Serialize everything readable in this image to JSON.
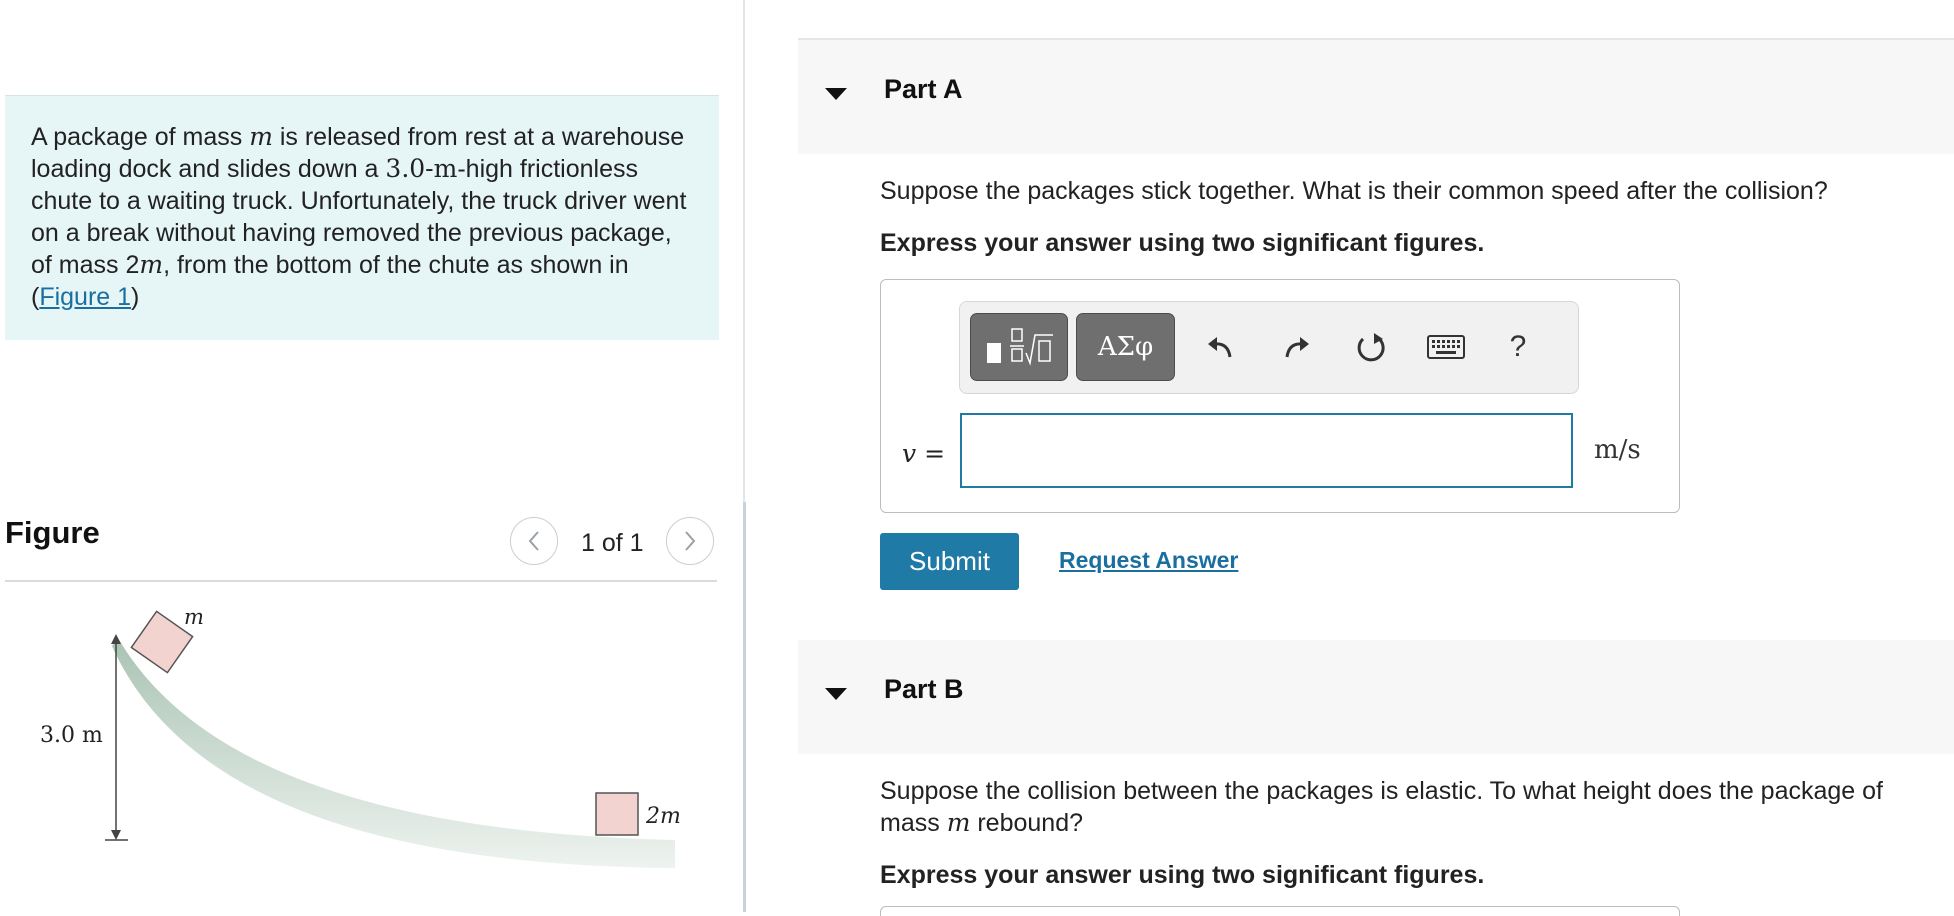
{
  "problem": {
    "text_1": "A package of mass ",
    "var_m": "m",
    "text_2": " is released from rest at a warehouse loading dock and slides down a ",
    "height_value": "3.0-",
    "height_unit": "m",
    "text_3": "-high frictionless chute to a waiting truck. Unfortunately, the truck driver went on a break without having removed the previous package, of mass 2",
    "var_m2": "m",
    "text_4": ", from the bottom of the chute as shown in (",
    "figure_link": "Figure 1",
    "text_5": ")"
  },
  "figure_panel": {
    "title": "Figure",
    "page_count": "1 of 1",
    "prev_icon": "chevron-left-icon",
    "next_icon": "chevron-right-icon",
    "diagram": {
      "label_m": "m",
      "label_2m": "2m",
      "label_height": "3.0 m",
      "block_color": "#f3d3cf",
      "chute_color": "#a9c3b4"
    }
  },
  "part_a": {
    "label": "Part A",
    "question": "Suppose the packages stick together. What is their common speed after the collision?",
    "instruction": "Express your answer using two significant figures.",
    "toolbar": {
      "template_icon": "math-template-icon",
      "greek_label": "ΑΣφ",
      "undo_icon": "undo-icon",
      "redo_icon": "redo-icon",
      "reset_icon": "reset-icon",
      "keyboard_icon": "keyboard-icon",
      "help_label": "?"
    },
    "variable": "v",
    "equals": " =",
    "input_value": "",
    "unit": "m/s",
    "submit_label": "Submit",
    "request_label": "Request Answer"
  },
  "part_b": {
    "label": "Part B",
    "question_1": "Suppose the collision between the packages is elastic. To what height does the package of mass ",
    "question_var": "m",
    "question_2": " rebound?",
    "instruction": "Express your answer using two significant figures."
  },
  "colors": {
    "accent": "#1f7ba5",
    "problem_bg": "#e6f5f6",
    "part_header_bg": "#f7f7f7"
  }
}
